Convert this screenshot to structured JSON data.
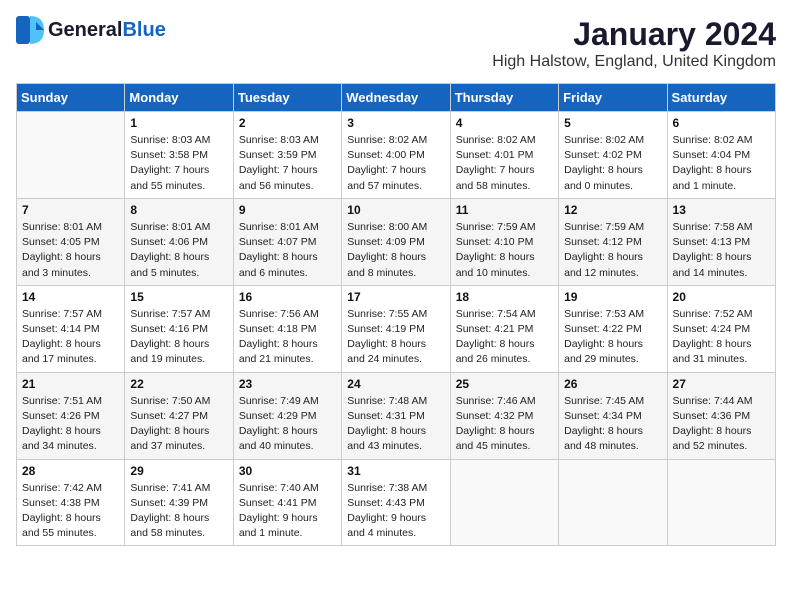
{
  "logo": {
    "general": "General",
    "blue": "Blue"
  },
  "calendar": {
    "title": "January 2024",
    "subtitle": "High Halstow, England, United Kingdom"
  },
  "headers": [
    "Sunday",
    "Monday",
    "Tuesday",
    "Wednesday",
    "Thursday",
    "Friday",
    "Saturday"
  ],
  "weeks": [
    [
      {
        "day": "",
        "info": ""
      },
      {
        "day": "1",
        "info": "Sunrise: 8:03 AM\nSunset: 3:58 PM\nDaylight: 7 hours\nand 55 minutes."
      },
      {
        "day": "2",
        "info": "Sunrise: 8:03 AM\nSunset: 3:59 PM\nDaylight: 7 hours\nand 56 minutes."
      },
      {
        "day": "3",
        "info": "Sunrise: 8:02 AM\nSunset: 4:00 PM\nDaylight: 7 hours\nand 57 minutes."
      },
      {
        "day": "4",
        "info": "Sunrise: 8:02 AM\nSunset: 4:01 PM\nDaylight: 7 hours\nand 58 minutes."
      },
      {
        "day": "5",
        "info": "Sunrise: 8:02 AM\nSunset: 4:02 PM\nDaylight: 8 hours\nand 0 minutes."
      },
      {
        "day": "6",
        "info": "Sunrise: 8:02 AM\nSunset: 4:04 PM\nDaylight: 8 hours\nand 1 minute."
      }
    ],
    [
      {
        "day": "7",
        "info": "Sunrise: 8:01 AM\nSunset: 4:05 PM\nDaylight: 8 hours\nand 3 minutes."
      },
      {
        "day": "8",
        "info": "Sunrise: 8:01 AM\nSunset: 4:06 PM\nDaylight: 8 hours\nand 5 minutes."
      },
      {
        "day": "9",
        "info": "Sunrise: 8:01 AM\nSunset: 4:07 PM\nDaylight: 8 hours\nand 6 minutes."
      },
      {
        "day": "10",
        "info": "Sunrise: 8:00 AM\nSunset: 4:09 PM\nDaylight: 8 hours\nand 8 minutes."
      },
      {
        "day": "11",
        "info": "Sunrise: 7:59 AM\nSunset: 4:10 PM\nDaylight: 8 hours\nand 10 minutes."
      },
      {
        "day": "12",
        "info": "Sunrise: 7:59 AM\nSunset: 4:12 PM\nDaylight: 8 hours\nand 12 minutes."
      },
      {
        "day": "13",
        "info": "Sunrise: 7:58 AM\nSunset: 4:13 PM\nDaylight: 8 hours\nand 14 minutes."
      }
    ],
    [
      {
        "day": "14",
        "info": "Sunrise: 7:57 AM\nSunset: 4:14 PM\nDaylight: 8 hours\nand 17 minutes."
      },
      {
        "day": "15",
        "info": "Sunrise: 7:57 AM\nSunset: 4:16 PM\nDaylight: 8 hours\nand 19 minutes."
      },
      {
        "day": "16",
        "info": "Sunrise: 7:56 AM\nSunset: 4:18 PM\nDaylight: 8 hours\nand 21 minutes."
      },
      {
        "day": "17",
        "info": "Sunrise: 7:55 AM\nSunset: 4:19 PM\nDaylight: 8 hours\nand 24 minutes."
      },
      {
        "day": "18",
        "info": "Sunrise: 7:54 AM\nSunset: 4:21 PM\nDaylight: 8 hours\nand 26 minutes."
      },
      {
        "day": "19",
        "info": "Sunrise: 7:53 AM\nSunset: 4:22 PM\nDaylight: 8 hours\nand 29 minutes."
      },
      {
        "day": "20",
        "info": "Sunrise: 7:52 AM\nSunset: 4:24 PM\nDaylight: 8 hours\nand 31 minutes."
      }
    ],
    [
      {
        "day": "21",
        "info": "Sunrise: 7:51 AM\nSunset: 4:26 PM\nDaylight: 8 hours\nand 34 minutes."
      },
      {
        "day": "22",
        "info": "Sunrise: 7:50 AM\nSunset: 4:27 PM\nDaylight: 8 hours\nand 37 minutes."
      },
      {
        "day": "23",
        "info": "Sunrise: 7:49 AM\nSunset: 4:29 PM\nDaylight: 8 hours\nand 40 minutes."
      },
      {
        "day": "24",
        "info": "Sunrise: 7:48 AM\nSunset: 4:31 PM\nDaylight: 8 hours\nand 43 minutes."
      },
      {
        "day": "25",
        "info": "Sunrise: 7:46 AM\nSunset: 4:32 PM\nDaylight: 8 hours\nand 45 minutes."
      },
      {
        "day": "26",
        "info": "Sunrise: 7:45 AM\nSunset: 4:34 PM\nDaylight: 8 hours\nand 48 minutes."
      },
      {
        "day": "27",
        "info": "Sunrise: 7:44 AM\nSunset: 4:36 PM\nDaylight: 8 hours\nand 52 minutes."
      }
    ],
    [
      {
        "day": "28",
        "info": "Sunrise: 7:42 AM\nSunset: 4:38 PM\nDaylight: 8 hours\nand 55 minutes."
      },
      {
        "day": "29",
        "info": "Sunrise: 7:41 AM\nSunset: 4:39 PM\nDaylight: 8 hours\nand 58 minutes."
      },
      {
        "day": "30",
        "info": "Sunrise: 7:40 AM\nSunset: 4:41 PM\nDaylight: 9 hours\nand 1 minute."
      },
      {
        "day": "31",
        "info": "Sunrise: 7:38 AM\nSunset: 4:43 PM\nDaylight: 9 hours\nand 4 minutes."
      },
      {
        "day": "",
        "info": ""
      },
      {
        "day": "",
        "info": ""
      },
      {
        "day": "",
        "info": ""
      }
    ]
  ]
}
